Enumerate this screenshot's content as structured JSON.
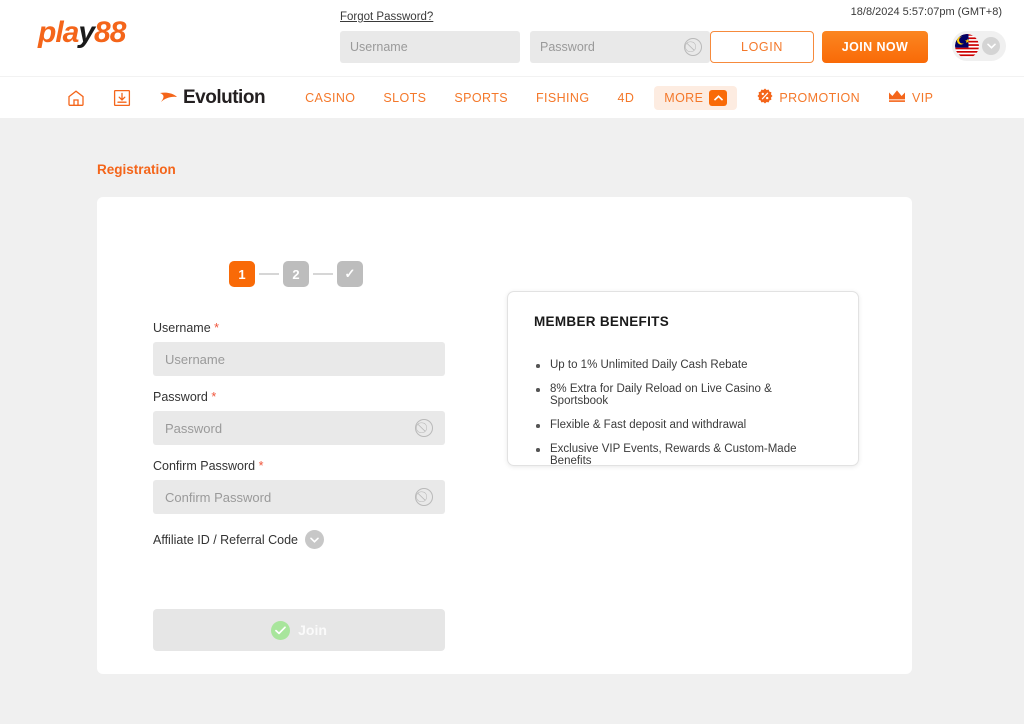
{
  "topbar": {
    "logo_main": "pla",
    "logo_bolt": "y",
    "logo_suffix": "88",
    "forgot_password": "Forgot Password?",
    "username_placeholder": "Username",
    "username_value": "",
    "password_placeholder": "Password",
    "password_value": "",
    "login_label": "LOGIN",
    "join_now_label": "JOIN NOW",
    "datetime": "18/8/2024 5:57:07pm (GMT+8)",
    "language": "Malaysia"
  },
  "nav": {
    "brand": "Evolution",
    "items": [
      {
        "label": "CASINO"
      },
      {
        "label": "SLOTS"
      },
      {
        "label": "SPORTS"
      },
      {
        "label": "FISHING"
      },
      {
        "label": "4D"
      },
      {
        "label": "MORE"
      },
      {
        "label": "PROMOTION"
      },
      {
        "label": "VIP"
      }
    ]
  },
  "page": {
    "title": "Registration",
    "stepper": [
      {
        "label": "1",
        "state": "active"
      },
      {
        "label": "2",
        "state": "idle"
      },
      {
        "label": "✓",
        "state": "idle"
      }
    ]
  },
  "form": {
    "username_label": "Username",
    "username_placeholder": "Username",
    "username_value": "",
    "password_label": "Password",
    "password_placeholder": "Password",
    "password_value": "",
    "confirm_label": "Confirm Password",
    "confirm_placeholder": "Confirm Password",
    "confirm_value": "",
    "required_mark": "*",
    "affiliate_label": "Affiliate ID / Referral Code",
    "submit_label": "Join"
  },
  "benefits": {
    "title": "MEMBER BENEFITS",
    "items": [
      "Up to 1% Unlimited Daily Cash Rebate",
      "8% Extra for Daily Reload on Live Casino & Sportsbook",
      "Flexible & Fast deposit and withdrawal",
      "Exclusive VIP Events, Rewards & Custom-Made Benefits"
    ]
  },
  "colors": {
    "brand_orange": "#f4651a",
    "accent_orange": "#f96a07",
    "required_red": "#f0543a",
    "page_bg": "#f0f0f0"
  }
}
